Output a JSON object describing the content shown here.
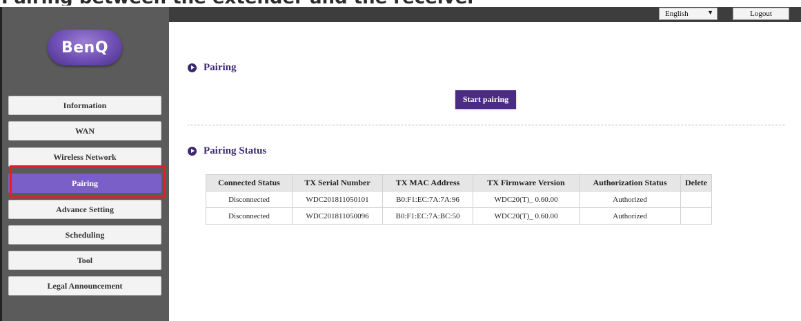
{
  "doc_heading": "Pairing between the extender and the receiver",
  "brand": {
    "logo_text": "BenQ"
  },
  "topbar": {
    "language": "English",
    "logout_label": "Logout"
  },
  "sidebar": {
    "items": [
      {
        "label": "Information",
        "active": false
      },
      {
        "label": "WAN",
        "active": false
      },
      {
        "label": "Wireless Network",
        "active": false
      },
      {
        "label": "Pairing",
        "active": true
      },
      {
        "label": "Advance Setting",
        "active": false
      },
      {
        "label": "Scheduling",
        "active": false
      },
      {
        "label": "Tool",
        "active": false
      },
      {
        "label": "Legal Announcement",
        "active": false
      }
    ]
  },
  "pairing": {
    "title": "Pairing",
    "start_button": "Start pairing"
  },
  "status": {
    "title": "Pairing Status",
    "headers": [
      "Connected Status",
      "TX Serial Number",
      "TX MAC Address",
      "TX Firmware Version",
      "Authorization Status",
      "Delete"
    ],
    "rows": [
      [
        "Disconnected",
        "WDC201811050101",
        "B0:F1:EC:7A:7A:96",
        "WDC20(T)_ 0.60.00",
        "Authorized",
        ""
      ],
      [
        "Disconnected",
        "WDC201811050096",
        "B0:F1:EC:7A:BC:50",
        "WDC20(T)_ 0.60.00",
        "Authorized",
        ""
      ]
    ]
  },
  "colors": {
    "accent": "#7b5fc8",
    "button": "#4b2c85",
    "title": "#3b2a6e",
    "highlight": "#e31e24"
  }
}
